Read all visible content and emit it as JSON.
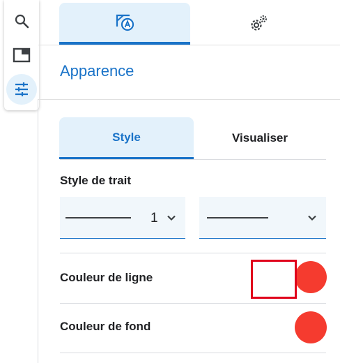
{
  "toolbar": {
    "items": [
      {
        "icon": "search-icon"
      },
      {
        "icon": "graphics-view-icon"
      },
      {
        "icon": "sliders-icon",
        "active": true
      }
    ]
  },
  "panel": {
    "top_tabs": [
      {
        "icon": "appearance-icon",
        "active": true
      },
      {
        "icon": "settings-gears-icon",
        "active": false
      }
    ],
    "title": "Apparence",
    "sub_tabs": [
      {
        "label": "Style",
        "active": true
      },
      {
        "label": "Visualiser",
        "active": false
      }
    ],
    "line_style": {
      "label": "Style de trait",
      "thickness_value": "1",
      "style_value": "solid"
    },
    "line_color": {
      "label": "Couleur de ligne",
      "color": "#f53b2f",
      "highlighted": true
    },
    "fill_color": {
      "label": "Couleur de fond",
      "color": "#f53b2f"
    }
  },
  "colors": {
    "accent": "#1a73c8",
    "active_bg": "#e3f1fb",
    "highlight_border": "#e0001b"
  }
}
